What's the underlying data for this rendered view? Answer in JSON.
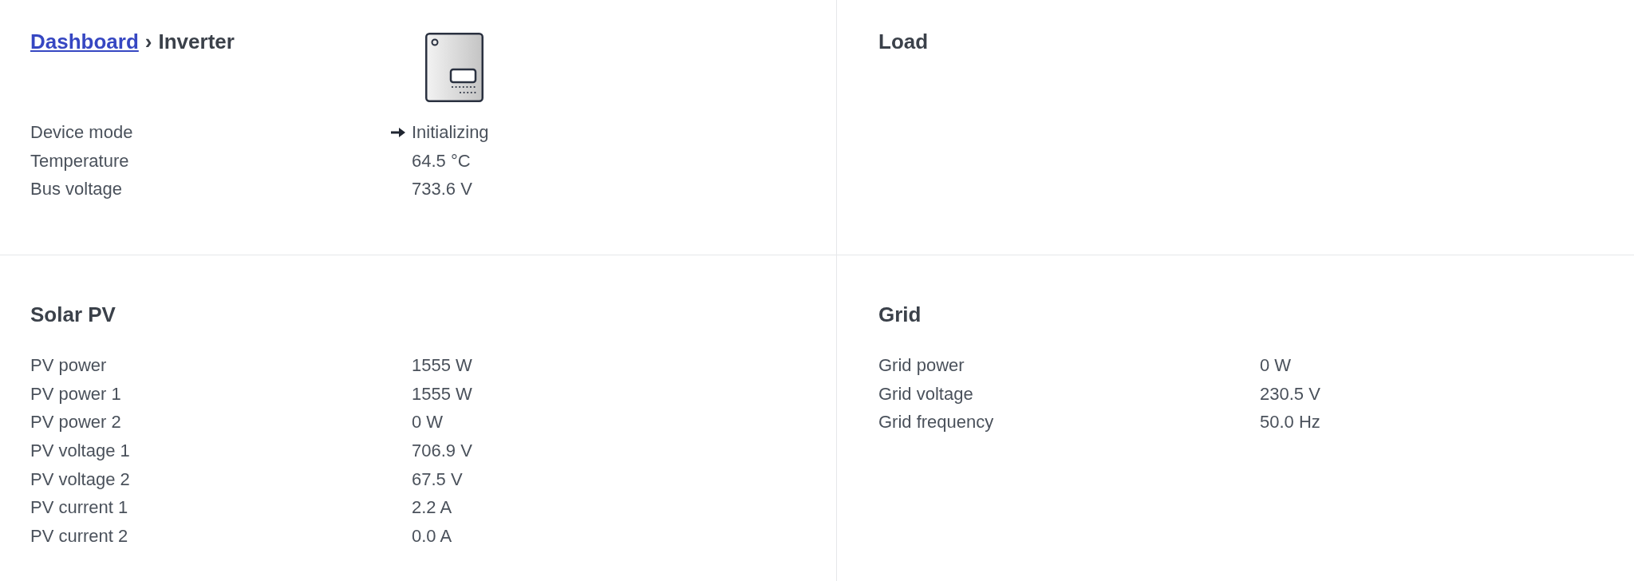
{
  "breadcrumb": {
    "link": "Dashboard",
    "separator": "›",
    "current": "Inverter"
  },
  "inverter": {
    "device_mode": {
      "label": "Device mode",
      "value": "Initializing"
    },
    "rows": [
      {
        "label": "Temperature",
        "value": "64.5 °C"
      },
      {
        "label": "Bus voltage",
        "value": "733.6 V"
      }
    ]
  },
  "load": {
    "title": "Load"
  },
  "solar_pv": {
    "title": "Solar PV",
    "rows": [
      {
        "label": "PV power",
        "value": "1555 W"
      },
      {
        "label": "PV power 1",
        "value": "1555 W"
      },
      {
        "label": "PV power 2",
        "value": "0 W"
      },
      {
        "label": "PV voltage 1",
        "value": "706.9 V"
      },
      {
        "label": "PV voltage 2",
        "value": "67.5 V"
      },
      {
        "label": "PV current 1",
        "value": "2.2 A"
      },
      {
        "label": "PV current 2",
        "value": "0.0 A"
      }
    ]
  },
  "grid": {
    "title": "Grid",
    "rows": [
      {
        "label": "Grid power",
        "value": "0 W"
      },
      {
        "label": "Grid voltage",
        "value": "230.5 V"
      },
      {
        "label": "Grid frequency",
        "value": "50.0 Hz"
      }
    ]
  }
}
